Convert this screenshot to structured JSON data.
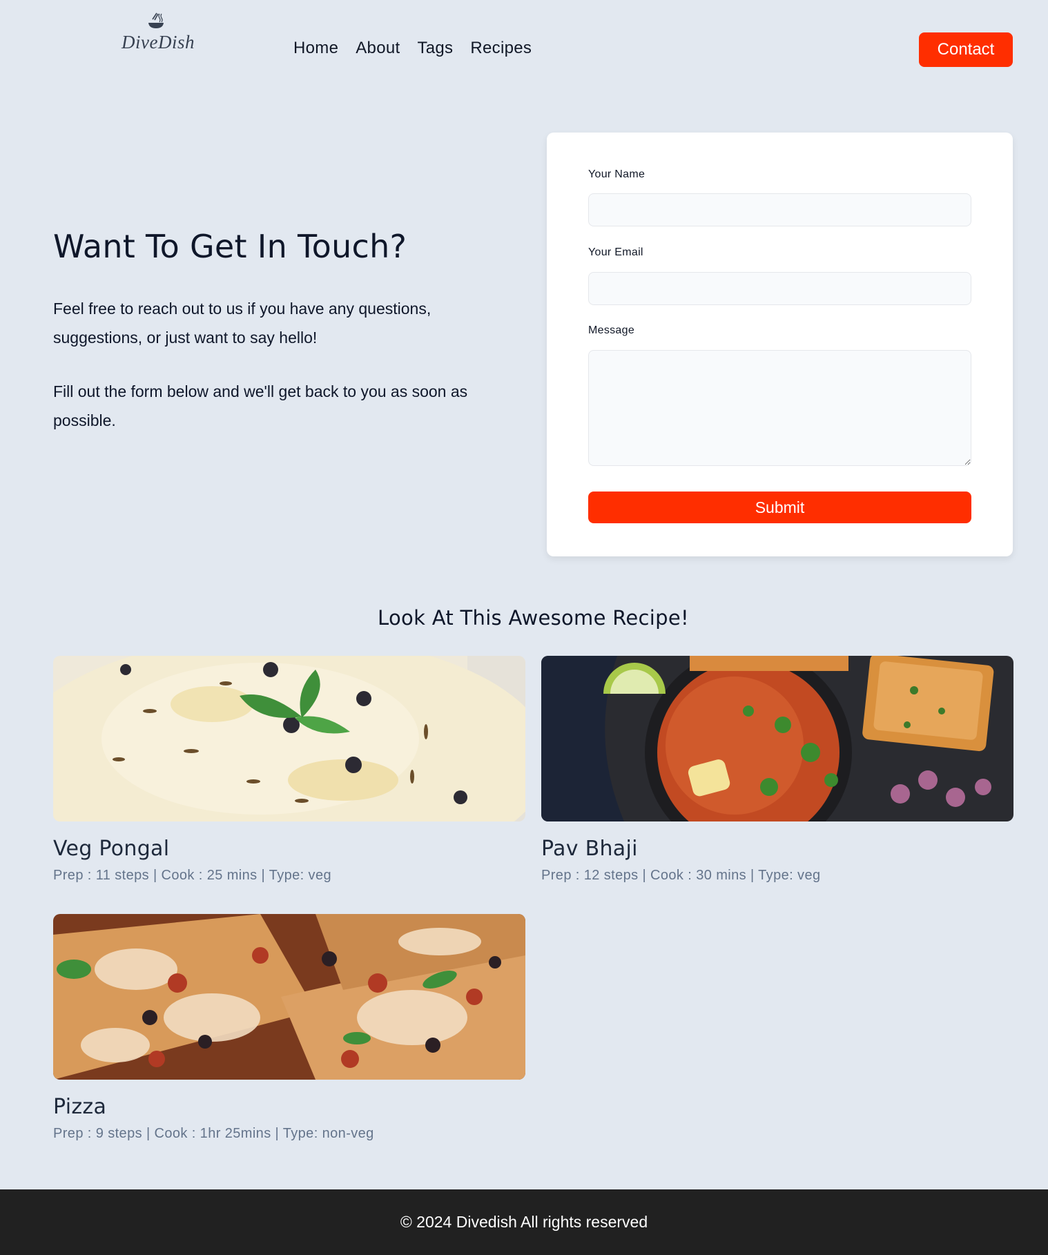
{
  "brand": {
    "name": "DiveDish",
    "logo_icon": "bowl-chopsticks-icon"
  },
  "nav": {
    "links": [
      "Home",
      "About",
      "Tags",
      "Recipes"
    ],
    "contact_label": "Contact"
  },
  "hero": {
    "title": "Want To Get In Touch?",
    "paragraph1": "Feel free to reach out to us if you have any questions, suggestions, or just want to say hello!",
    "paragraph2": "Fill out the form below and we'll get back to you as soon as possible."
  },
  "form": {
    "name_label": "Your Name",
    "name_value": "",
    "email_label": "Your Email",
    "email_value": "",
    "message_label": "Message",
    "message_value": "",
    "submit_label": "Submit"
  },
  "recipes": {
    "title": "Look At This Awesome Recipe!",
    "items": [
      {
        "name": "Veg Pongal",
        "meta": "Prep : 11 steps | Cook : 25 mins | Type: veg"
      },
      {
        "name": "Pav Bhaji",
        "meta": "Prep : 12 steps | Cook : 30 mins | Type: veg"
      },
      {
        "name": "Pizza",
        "meta": "Prep : 9 steps | Cook : 1hr 25mins | Type: non-veg"
      }
    ]
  },
  "footer": {
    "text": "© 2024 Divedish All rights reserved"
  },
  "colors": {
    "accent": "#ff2e00",
    "background": "#e2e8f0",
    "footer": "#212121"
  }
}
